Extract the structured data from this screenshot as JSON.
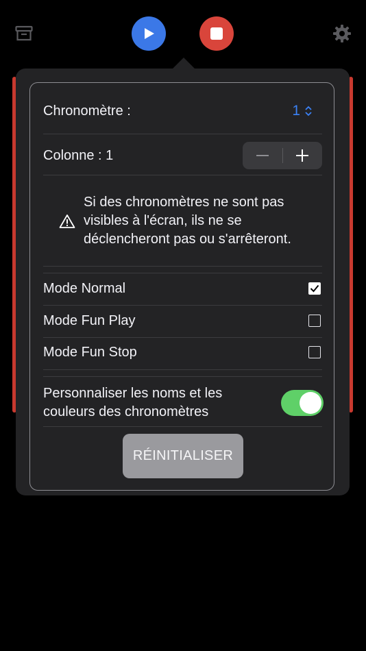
{
  "toolbar": {
    "archive_icon": "archive-box-icon",
    "play_icon": "play-icon",
    "stop_icon": "stop-icon",
    "settings_icon": "gear-icon",
    "play_color": "#3b78e7",
    "stop_color": "#d9453b"
  },
  "settings": {
    "chrono_label": "Chronomètre :",
    "chrono_value": "1",
    "column_label": "Colonne : 1",
    "stepper_minus": "—",
    "stepper_plus": "+",
    "warning_text": "Si des chronomètres ne sont pas visibles à l'écran, ils ne se déclencheront pas ou s'arrêteront.",
    "modes": [
      {
        "label": "Mode Normal",
        "checked": true
      },
      {
        "label": "Mode Fun Play",
        "checked": false
      },
      {
        "label": "Mode Fun Stop",
        "checked": false
      }
    ],
    "customize_label": "Personnaliser les noms et les couleurs des chronomètres",
    "customize_enabled": true,
    "reset_label": "RÉINITIALISER",
    "accent_color": "#3b82f6",
    "toggle_color": "#5fd068"
  }
}
